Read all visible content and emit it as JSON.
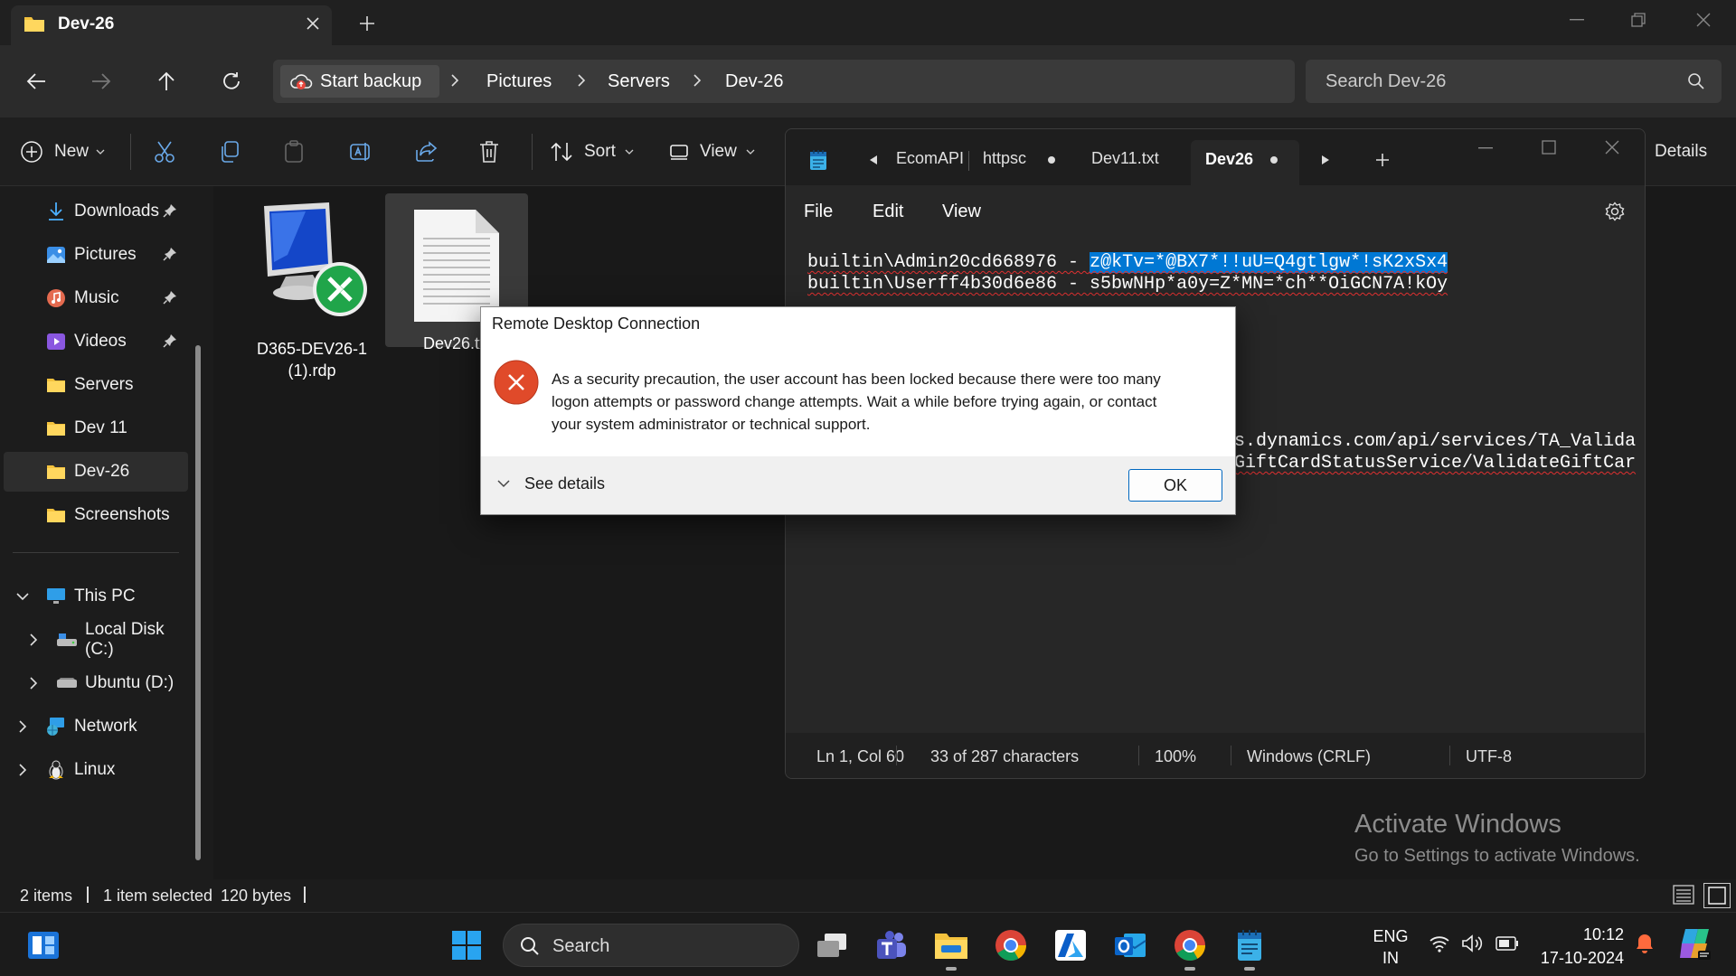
{
  "explorer": {
    "tab_title": "Dev-26",
    "address": {
      "backup_label": "Start backup",
      "crumbs": [
        "Pictures",
        "Servers",
        "Dev-26"
      ]
    },
    "search_placeholder": "Search Dev-26",
    "commands": {
      "new": "New",
      "sort": "Sort",
      "view": "View",
      "details": "Details"
    },
    "sidebar": {
      "quick": [
        {
          "label": "Downloads",
          "icon": "download-icon",
          "pinned": true
        },
        {
          "label": "Pictures",
          "icon": "pictures-icon",
          "pinned": true
        },
        {
          "label": "Music",
          "icon": "music-icon",
          "pinned": true
        },
        {
          "label": "Videos",
          "icon": "videos-icon",
          "pinned": true
        },
        {
          "label": "Servers",
          "icon": "folder-icon",
          "pinned": false
        },
        {
          "label": "Dev 11",
          "icon": "folder-icon",
          "pinned": false
        },
        {
          "label": "Dev-26",
          "icon": "folder-icon",
          "pinned": false,
          "selected": true
        },
        {
          "label": "Screenshots",
          "icon": "folder-icon",
          "pinned": false
        }
      ],
      "tree": [
        {
          "label": "This PC",
          "icon": "pc-icon"
        },
        {
          "label": "Local Disk (C:)",
          "icon": "drive-icon"
        },
        {
          "label": "Ubuntu (D:)",
          "icon": "drive-icon"
        },
        {
          "label": "Network",
          "icon": "network-icon"
        },
        {
          "label": "Linux",
          "icon": "linux-icon"
        }
      ]
    },
    "files": [
      {
        "line1": "D365-DEV26-1",
        "line2": "(1).rdp"
      },
      {
        "line1": "Dev26.txt"
      }
    ],
    "status": {
      "items": "2 items",
      "selected": "1 item selected",
      "size": "120 bytes"
    }
  },
  "notepad": {
    "tabs": [
      "EcomAPI",
      "httpsc",
      "Dev11.txt",
      "Dev26"
    ],
    "menu": {
      "file": "File",
      "edit": "Edit",
      "view": "View"
    },
    "lines": {
      "l1_prefix": "builtin\\Admin20cd668976 - ",
      "l1_selected": "z@kTv=*@BX7*!!uU=Q4gtlgw*!sK2xSx4",
      "l2": "builtin\\Userff4b30d6e86 - s5bwNHp*a0y=Z*MN=*ch**OiGCN7A!kOy",
      "l3": "ns.dynamics.com/api/services/TA_Valida",
      "l4": "eGiftCardStatusService/ValidateGiftCar"
    },
    "status": {
      "position": "Ln 1, Col 60",
      "chars": "33 of 287 characters",
      "zoom": "100%",
      "eol": "Windows (CRLF)",
      "encoding": "UTF-8"
    }
  },
  "dialog": {
    "title": "Remote Desktop Connection",
    "message_lines": [
      "As a security precaution, the user account has been locked because there were too many",
      "logon attempts or password change attempts. Wait a while before trying again, or contact",
      "your system administrator or technical support."
    ],
    "details_label": "See details",
    "ok_label": "OK"
  },
  "watermark": {
    "title": "Activate Windows",
    "subtitle": "Go to Settings to activate Windows."
  },
  "taskbar": {
    "search_label": "Search",
    "lang": "ENG",
    "region": "IN",
    "time": "10:12",
    "date": "17-10-2024"
  },
  "colors": {
    "selection": "#0078d4",
    "folder": "#f4c23d",
    "error": "#e04a2a",
    "accent": "#0067c0"
  }
}
